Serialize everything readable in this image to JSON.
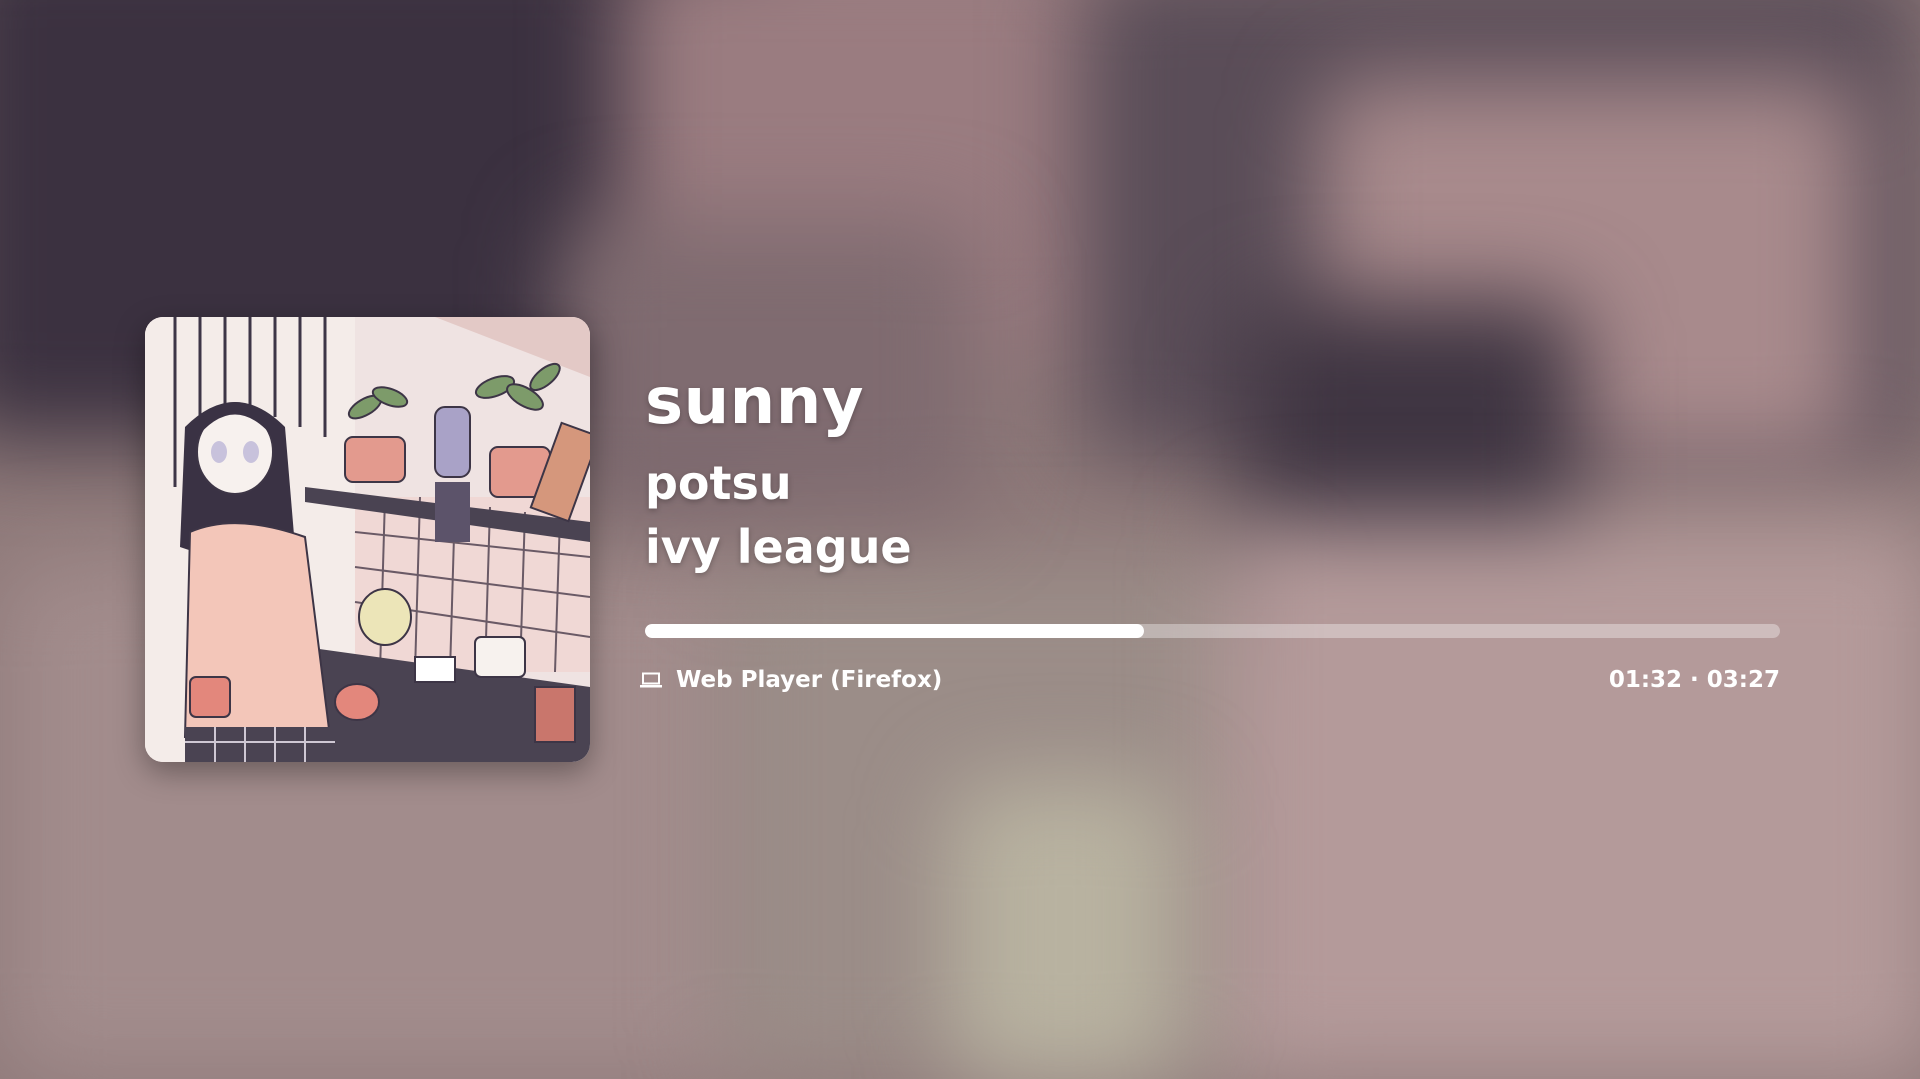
{
  "track": {
    "title": "sunny",
    "artist": "potsu",
    "album": "ivy league"
  },
  "playback": {
    "device_icon": "laptop-icon",
    "device": "Web Player (Firefox)",
    "time_display": "01:32 · 03:27",
    "elapsed": "01:32",
    "duration": "03:27",
    "progress_fraction": 0.44
  },
  "colors": {
    "text": "#ffffff",
    "progress_fill": "#ffffff",
    "progress_track": "#ffffff59"
  }
}
